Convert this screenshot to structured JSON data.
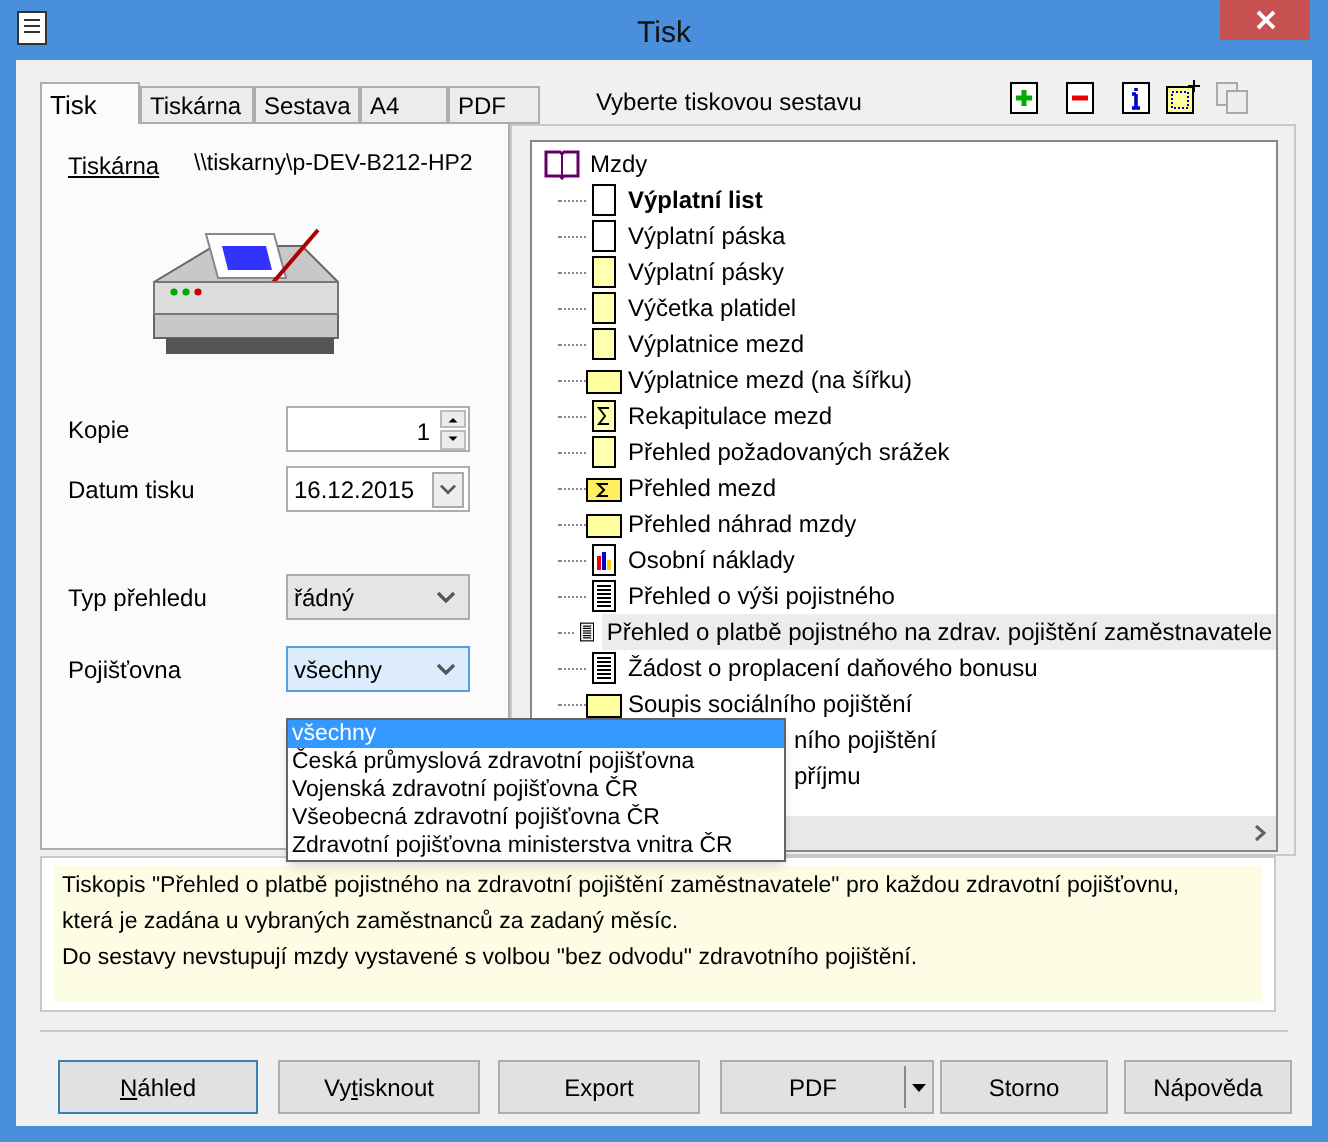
{
  "window": {
    "title": "Tisk"
  },
  "tabs": [
    {
      "label": "Tisk",
      "selected": true
    },
    {
      "label": "Tiskárna",
      "selected": false
    },
    {
      "label": "Sestava",
      "selected": false
    },
    {
      "label": "A4",
      "selected": false
    },
    {
      "label": "PDF",
      "selected": false
    }
  ],
  "report_label": "Vyberte tiskovou sestavu",
  "printer": {
    "link": "Tiskárna",
    "path": "\\\\tiskarny\\p-DEV-B212-HP2"
  },
  "fields": [
    {
      "kind": "spinner",
      "label": "Kopie",
      "value": "1"
    },
    {
      "kind": "date",
      "label": "Datum tisku",
      "value": "16.12.2015"
    },
    {
      "kind": "select",
      "label": "Typ přehledu",
      "value": "řádný",
      "expanded": false
    },
    {
      "kind": "select",
      "label": "Pojišťovna",
      "value": "všechny",
      "expanded": true,
      "options": [
        {
          "label": "všechny",
          "selected": true
        },
        {
          "label": "Česká průmyslová zdravotní pojišťovna",
          "selected": false
        },
        {
          "label": "Vojenská zdravotní pojišťovna ČR",
          "selected": false
        },
        {
          "label": "Všeobecná zdravotní pojišťovna ČR",
          "selected": false
        },
        {
          "label": "Zdravotní pojišťovna ministerstva vnitra ČR",
          "selected": false
        }
      ]
    }
  ],
  "tree": {
    "label": "Mzdy",
    "children": [
      {
        "label": "Výplatní list",
        "kind": "page",
        "bold": true,
        "selected": false
      },
      {
        "label": "Výplatní páska",
        "kind": "page",
        "bold": false,
        "selected": false
      },
      {
        "label": "Výplatní pásky",
        "kind": "yellow-page",
        "bold": false,
        "selected": false
      },
      {
        "label": "Výčetka platidel",
        "kind": "yellow-page",
        "bold": false,
        "selected": false
      },
      {
        "label": "Výplatnice mezd",
        "kind": "yellow-page",
        "bold": false,
        "selected": false
      },
      {
        "label": "Výplatnice mezd (na šířku)",
        "kind": "landscape",
        "bold": false,
        "selected": false
      },
      {
        "label": "Rekapitulace mezd",
        "kind": "sigma-page",
        "bold": false,
        "selected": false
      },
      {
        "label": "Přehled požadovaných srážek",
        "kind": "yellow-page",
        "bold": false,
        "selected": false
      },
      {
        "label": "Přehled mezd",
        "kind": "sigma-landscape",
        "bold": false,
        "selected": false
      },
      {
        "label": "Přehled náhrad mzdy",
        "kind": "landscape",
        "bold": false,
        "selected": false
      },
      {
        "label": "Osobní náklady",
        "kind": "chart-page",
        "bold": false,
        "selected": false
      },
      {
        "label": "Přehled o výši pojistného",
        "kind": "text-page",
        "bold": false,
        "selected": false
      },
      {
        "label": "Přehled o platbě pojistného na zdrav. pojištění zaměstnavatele",
        "kind": "text-page",
        "bold": false,
        "selected": true
      },
      {
        "label": "Žádost o proplacení daňového bonusu",
        "kind": "text-page",
        "bold": false,
        "selected": false
      },
      {
        "label": "Soupis sociálního pojištění",
        "kind": "landscape",
        "bold": false,
        "selected": false
      },
      {
        "label": "ního pojištění",
        "kind": "covered",
        "bold": false,
        "selected": false
      },
      {
        "label": "příjmu",
        "kind": "covered",
        "bold": false,
        "selected": false
      }
    ]
  },
  "description": [
    "Tiskopis \"Přehled o platbě pojistného na zdravotní pojištění zaměstnavatele\" pro každou zdravotní pojišťovnu,",
    "která je zadána u vybraných zaměstnanců za zadaný měsíc.",
    "Do sestavy nevstupují mzdy vystavené s volbou \"bez odvodu\" zdravotního pojištění."
  ],
  "buttons": [
    {
      "access_key": "N",
      "label": "áhled",
      "default": true,
      "kind": "plain"
    },
    {
      "label_before": "Vy",
      "access_key": "t",
      "label": "isknout",
      "default": false,
      "kind": "plain"
    },
    {
      "label": "Export",
      "default": false,
      "kind": "plain"
    },
    {
      "label": "PDF",
      "default": false,
      "kind": "split"
    },
    {
      "label": "Storno",
      "default": false,
      "kind": "plain"
    },
    {
      "label": "Nápověda",
      "default": false,
      "kind": "plain"
    }
  ]
}
